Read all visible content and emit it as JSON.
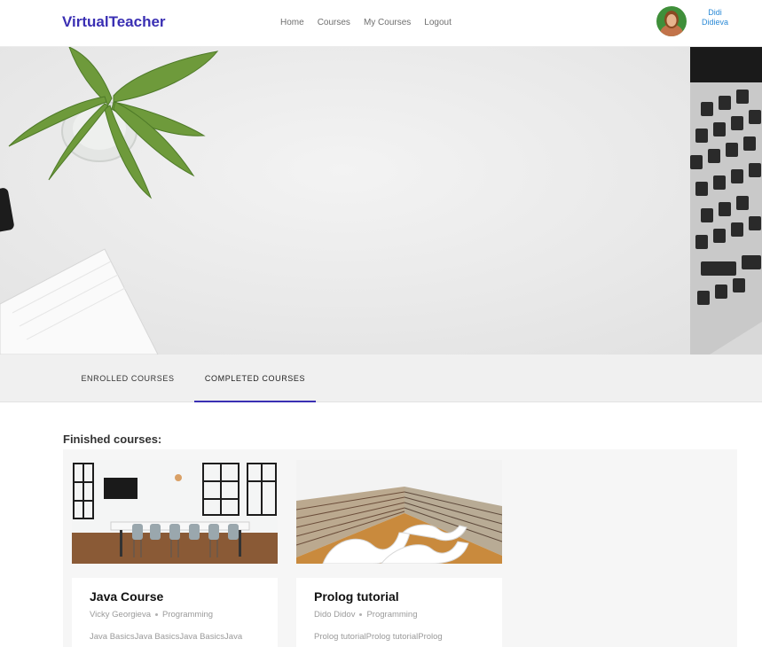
{
  "header": {
    "brand": "VirtualTeacher",
    "nav": [
      {
        "label": "Home"
      },
      {
        "label": "Courses"
      },
      {
        "label": "My Courses"
      },
      {
        "label": "Logout"
      }
    ],
    "user": {
      "first_name": "Didi",
      "last_name": "Didieva"
    }
  },
  "tabs": [
    {
      "label": "ENROLLED COURSES",
      "active": false
    },
    {
      "label": "COMPLETED COURSES",
      "active": true
    }
  ],
  "main": {
    "section_title": "Finished courses:",
    "courses": [
      {
        "title": "Java Course",
        "author": "Vicky Georgieva",
        "category": "Programming",
        "description": "Java BasicsJava BasicsJava BasicsJava",
        "image": "meeting-room-photo"
      },
      {
        "title": "Prolog tutorial",
        "author": "Dido Didov",
        "category": "Programming",
        "description": "Prolog tutorialProlog tutorialProlog",
        "image": "library-bookshelves-photo"
      }
    ]
  },
  "colors": {
    "brand": "#3a2fb3",
    "user_link": "#2b8ad6",
    "active_tab_underline": "#3a2fb3"
  }
}
